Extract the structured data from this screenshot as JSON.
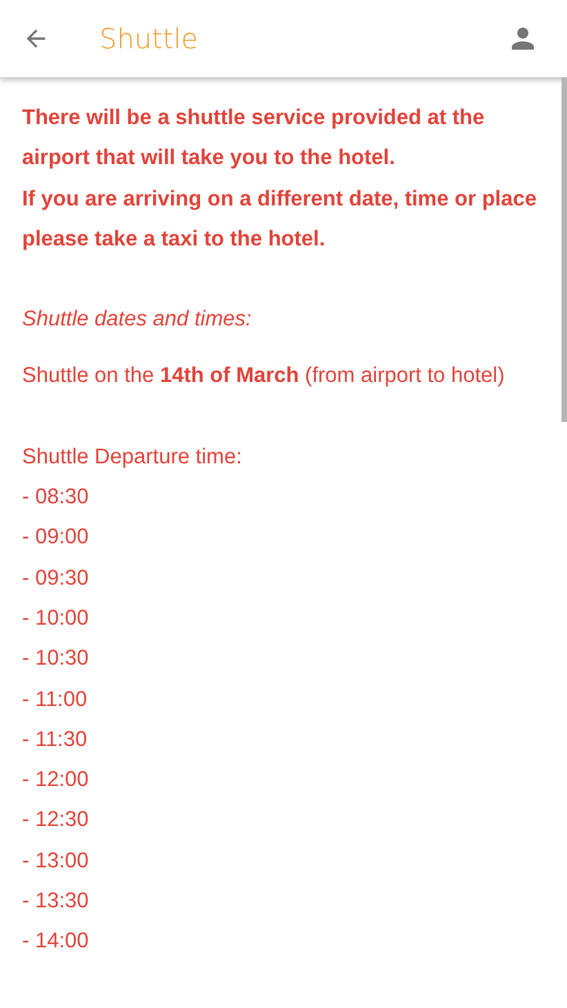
{
  "app_bar": {
    "title": "Shuttle"
  },
  "intro": [
    "There will be a shuttle service provided at the airport that will take you to the hotel.",
    "If you are arriving on a different date, time or place please take a taxi to the hotel."
  ],
  "section_heading": "Shuttle dates and times:",
  "shuttle_line": "Shuttle on the **14th of March** (from airport to hotel)",
  "departure_label": "Shuttle Departure time:",
  "times": [
    "- 08:30",
    "- 09:00",
    "- 09:30",
    "- 10:00",
    "- 10:30",
    "- 11:00",
    "- 11:30",
    "- 12:00",
    "- 12:30",
    "- 13:00",
    "- 13:30",
    "- 14:00"
  ]
}
